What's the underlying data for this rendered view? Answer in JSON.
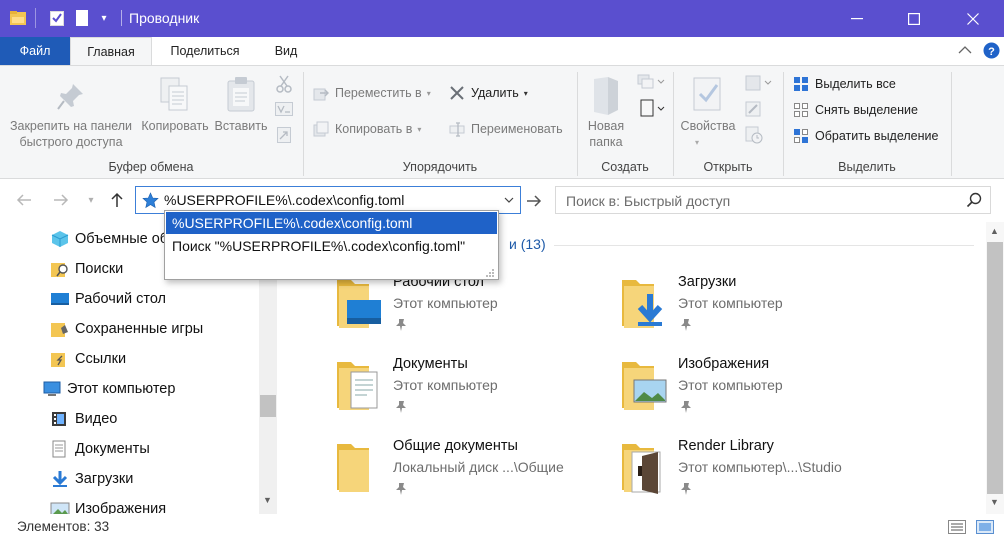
{
  "window": {
    "title": "Проводник"
  },
  "ribbon_tabs": [
    "Файл",
    "Главная",
    "Поделиться",
    "Вид"
  ],
  "ribbon": {
    "clipboard": {
      "pin_label_1": "Закрепить на панели",
      "pin_label_2": "быстрого доступа",
      "copy_label": "Копировать",
      "paste_label": "Вставить",
      "group_label": "Буфер обмена"
    },
    "organize": {
      "move_to": "Переместить в",
      "copy_to": "Копировать в",
      "delete": "Удалить",
      "rename": "Переименовать",
      "group_label": "Упорядочить"
    },
    "new": {
      "new_folder_1": "Новая",
      "new_folder_2": "папка",
      "group_label": "Создать"
    },
    "open": {
      "properties": "Свойства",
      "group_label": "Открыть"
    },
    "select": {
      "select_all": "Выделить все",
      "select_none": "Снять выделение",
      "invert_selection": "Обратить выделение",
      "group_label": "Выделить"
    }
  },
  "address_bar": {
    "value": "%USERPROFILE%\\.codex\\config.toml"
  },
  "search": {
    "placeholder": "Поиск в: Быстрый доступ"
  },
  "autocomplete": {
    "items": [
      "%USERPROFILE%\\.codex\\config.toml",
      "Поиск \"%USERPROFILE%\\.codex\\config.toml\""
    ]
  },
  "nav_pane": {
    "items": [
      {
        "label": "Объемные объекты",
        "icon": "3d-objects-icon"
      },
      {
        "label": "Поиски",
        "icon": "searches-folder-icon"
      },
      {
        "label": "Рабочий стол",
        "icon": "desktop-icon"
      },
      {
        "label": "Сохраненные игры",
        "icon": "saved-games-icon"
      },
      {
        "label": "Ссылки",
        "icon": "links-folder-icon"
      },
      {
        "label": "Этот компьютер",
        "icon": "this-pc-icon"
      },
      {
        "label": "Видео",
        "icon": "videos-icon"
      },
      {
        "label": "Документы",
        "icon": "documents-icon"
      },
      {
        "label": "Загрузки",
        "icon": "downloads-icon"
      },
      {
        "label": "Изображения",
        "icon": "pictures-icon"
      }
    ]
  },
  "content": {
    "section_header": "и (13)",
    "tiles": [
      {
        "name": "Рабочий стол",
        "sub": "Этот компьютер"
      },
      {
        "name": "Загрузки",
        "sub": "Этот компьютер"
      },
      {
        "name": "Документы",
        "sub": "Этот компьютер"
      },
      {
        "name": "Изображения",
        "sub": "Этот компьютер"
      },
      {
        "name": "Общие документы",
        "sub": "Локальный диск ...\\Общие"
      },
      {
        "name": "Render Library",
        "sub": "Этот компьютер\\...\\Studio"
      }
    ]
  },
  "status": {
    "item_count": "Элементов: 33"
  },
  "colors": {
    "titlebar": "#5a4fcf",
    "file_tab": "#1f5bb7",
    "selection": "#1f62c8",
    "folder": "#f3c653"
  }
}
